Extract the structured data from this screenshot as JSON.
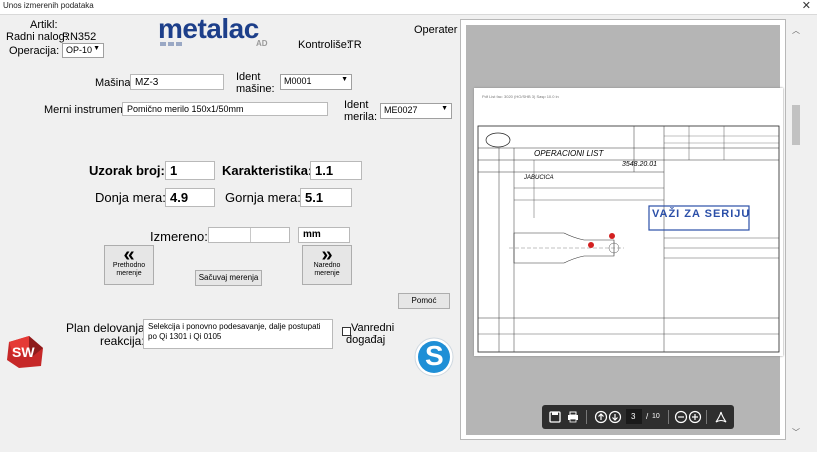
{
  "window": {
    "title": "Unos izmerenih podataka",
    "close_glyph": "✕"
  },
  "header": {
    "artikl_label": "Artikl:",
    "artikl_value": "",
    "radni_nalog_label": "Radni nalog:",
    "radni_nalog_value": "RN352",
    "operacija_label": "Operacija:",
    "operacija_value": "OP-10",
    "logo_text": "metalac",
    "logo_sub": "AD",
    "kontrolise_label": "Kontroliše:",
    "kontrolise_value": "TR",
    "operater_label": "Operater"
  },
  "machine": {
    "masina_label": "Mašina:",
    "masina_value": "MZ-3",
    "ident_masine_label_1": "Ident",
    "ident_masine_label_2": "mašine:",
    "ident_masine_value": "M0001",
    "merni_label": "Merni instrument:",
    "merni_value": "Pomično merilo 150x1/50mm",
    "ident_merila_label_1": "Ident",
    "ident_merila_label_2": "merila:",
    "ident_merila_value": "ME0027"
  },
  "measure": {
    "uzorak_label": "Uzorak broj:",
    "uzorak_value": "1",
    "karakteristika_label": "Karakteristika:",
    "karakteristika_value": "1.1",
    "donja_label": "Donja mera:",
    "donja_value": "4.9",
    "gornja_label": "Gornja mera:",
    "gornja_value": "5.1",
    "izmereno_label": "Izmereno:",
    "izmereno_value": "",
    "unit_value": "mm"
  },
  "buttons": {
    "prethodno_1": "Prethodno",
    "prethodno_2": "merenje",
    "sacuvaj": "Sačuvaj merenja",
    "naredno_1": "Naredno",
    "naredno_2": "merenje",
    "pomoc": "Pomoć",
    "chev_left": "«",
    "chev_right": "»"
  },
  "plan": {
    "label_1": "Plan delovanja -",
    "label_2": "reakcija:",
    "text": "Selekcija i ponovno podesavanje, dalje postupati po Qi 1301 i Qi 0105",
    "vanredni_1": "Vanredni",
    "vanredni_2": "događaj"
  },
  "icons": {
    "sw_text": "SW",
    "s_text": "S"
  },
  "pdf": {
    "header_text": "Pdf List fac: 3020 (HO/SHB 3) Sasp 10.0 in",
    "doc_title": "OPERACIONI LIST",
    "doc_code": "3548.20.01",
    "part_name": "JABUCICA",
    "stamp": "VAŽI ZA SERIJU",
    "page_current": "3",
    "page_sep": "/",
    "page_total": "10"
  },
  "colors": {
    "logo": "#1d3f8a",
    "stamp": "#2b4fa8",
    "badge": "#d32020"
  }
}
